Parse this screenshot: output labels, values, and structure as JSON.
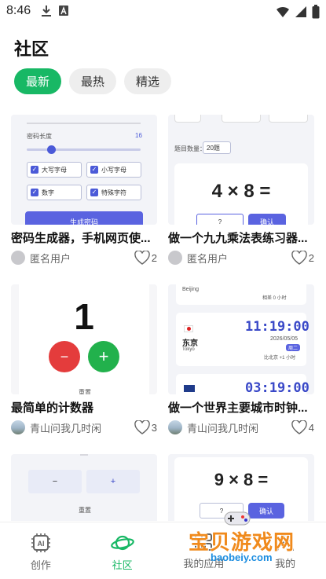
{
  "status_bar": {
    "time": "8:46"
  },
  "page": {
    "title": "社区"
  },
  "tabs": [
    {
      "label": "最新",
      "active": true
    },
    {
      "label": "最热",
      "active": false
    },
    {
      "label": "精选",
      "active": false
    }
  ],
  "cards": [
    {
      "title": "密码生成器，手机网页使...",
      "author": "匿名用户",
      "likes": "2",
      "thumb": {
        "length_label": "密码长度",
        "length_value": "16",
        "options": [
          "大写字母",
          "小写字母",
          "数字",
          "特殊字符"
        ],
        "button": "生成密码"
      }
    },
    {
      "title": "做一个九九乘法表练习器...",
      "author": "匿名用户",
      "likes": "2",
      "thumb": {
        "count_label": "题目数量：",
        "count_value": "20题",
        "equation": "4 × 8 =",
        "answer": "?",
        "confirm": "确认"
      }
    },
    {
      "title": "最简单的计数器",
      "author": "青山问我几时闲",
      "likes": "3",
      "thumb": {
        "count": "1",
        "minus": "−",
        "plus": "+",
        "reset": "重置"
      }
    },
    {
      "title": "做一个世界主要城市时钟...",
      "author": "青山问我几时闲",
      "likes": "4",
      "thumb": {
        "top_city": "Beijing",
        "top_note": "相差 0 小时",
        "city_cn": "东京",
        "city_en": "Tokyo",
        "time1": "11:19:00",
        "date1": "2026/05/05",
        "day1": "周二",
        "diff1": "比北京 +1 小时",
        "time2": "03:19:00"
      }
    },
    {
      "title": "",
      "author": "",
      "likes": "",
      "thumb": {
        "minus": "−",
        "plus": "+",
        "reset": "重置"
      }
    },
    {
      "title": "",
      "author": "",
      "likes": "",
      "thumb": {
        "equation": "9 × 8 =",
        "answer": "?",
        "confirm": "确认"
      }
    }
  ],
  "bottom_nav": [
    {
      "label": "创作",
      "icon": "ai-create-icon",
      "active": false
    },
    {
      "label": "社区",
      "icon": "planet-icon",
      "active": true
    },
    {
      "label": "我的应用",
      "icon": "apps-icon",
      "active": false
    },
    {
      "label": "我的",
      "icon": "profile-icon",
      "active": false
    }
  ],
  "watermark": {
    "text": "宝贝游戏网",
    "url": "baobeiy.com"
  },
  "colors": {
    "accent": "#18b865",
    "thumb_accent": "#5a63e0",
    "watermark_orange": "#f08a1c",
    "watermark_blue": "#1c8de0"
  }
}
